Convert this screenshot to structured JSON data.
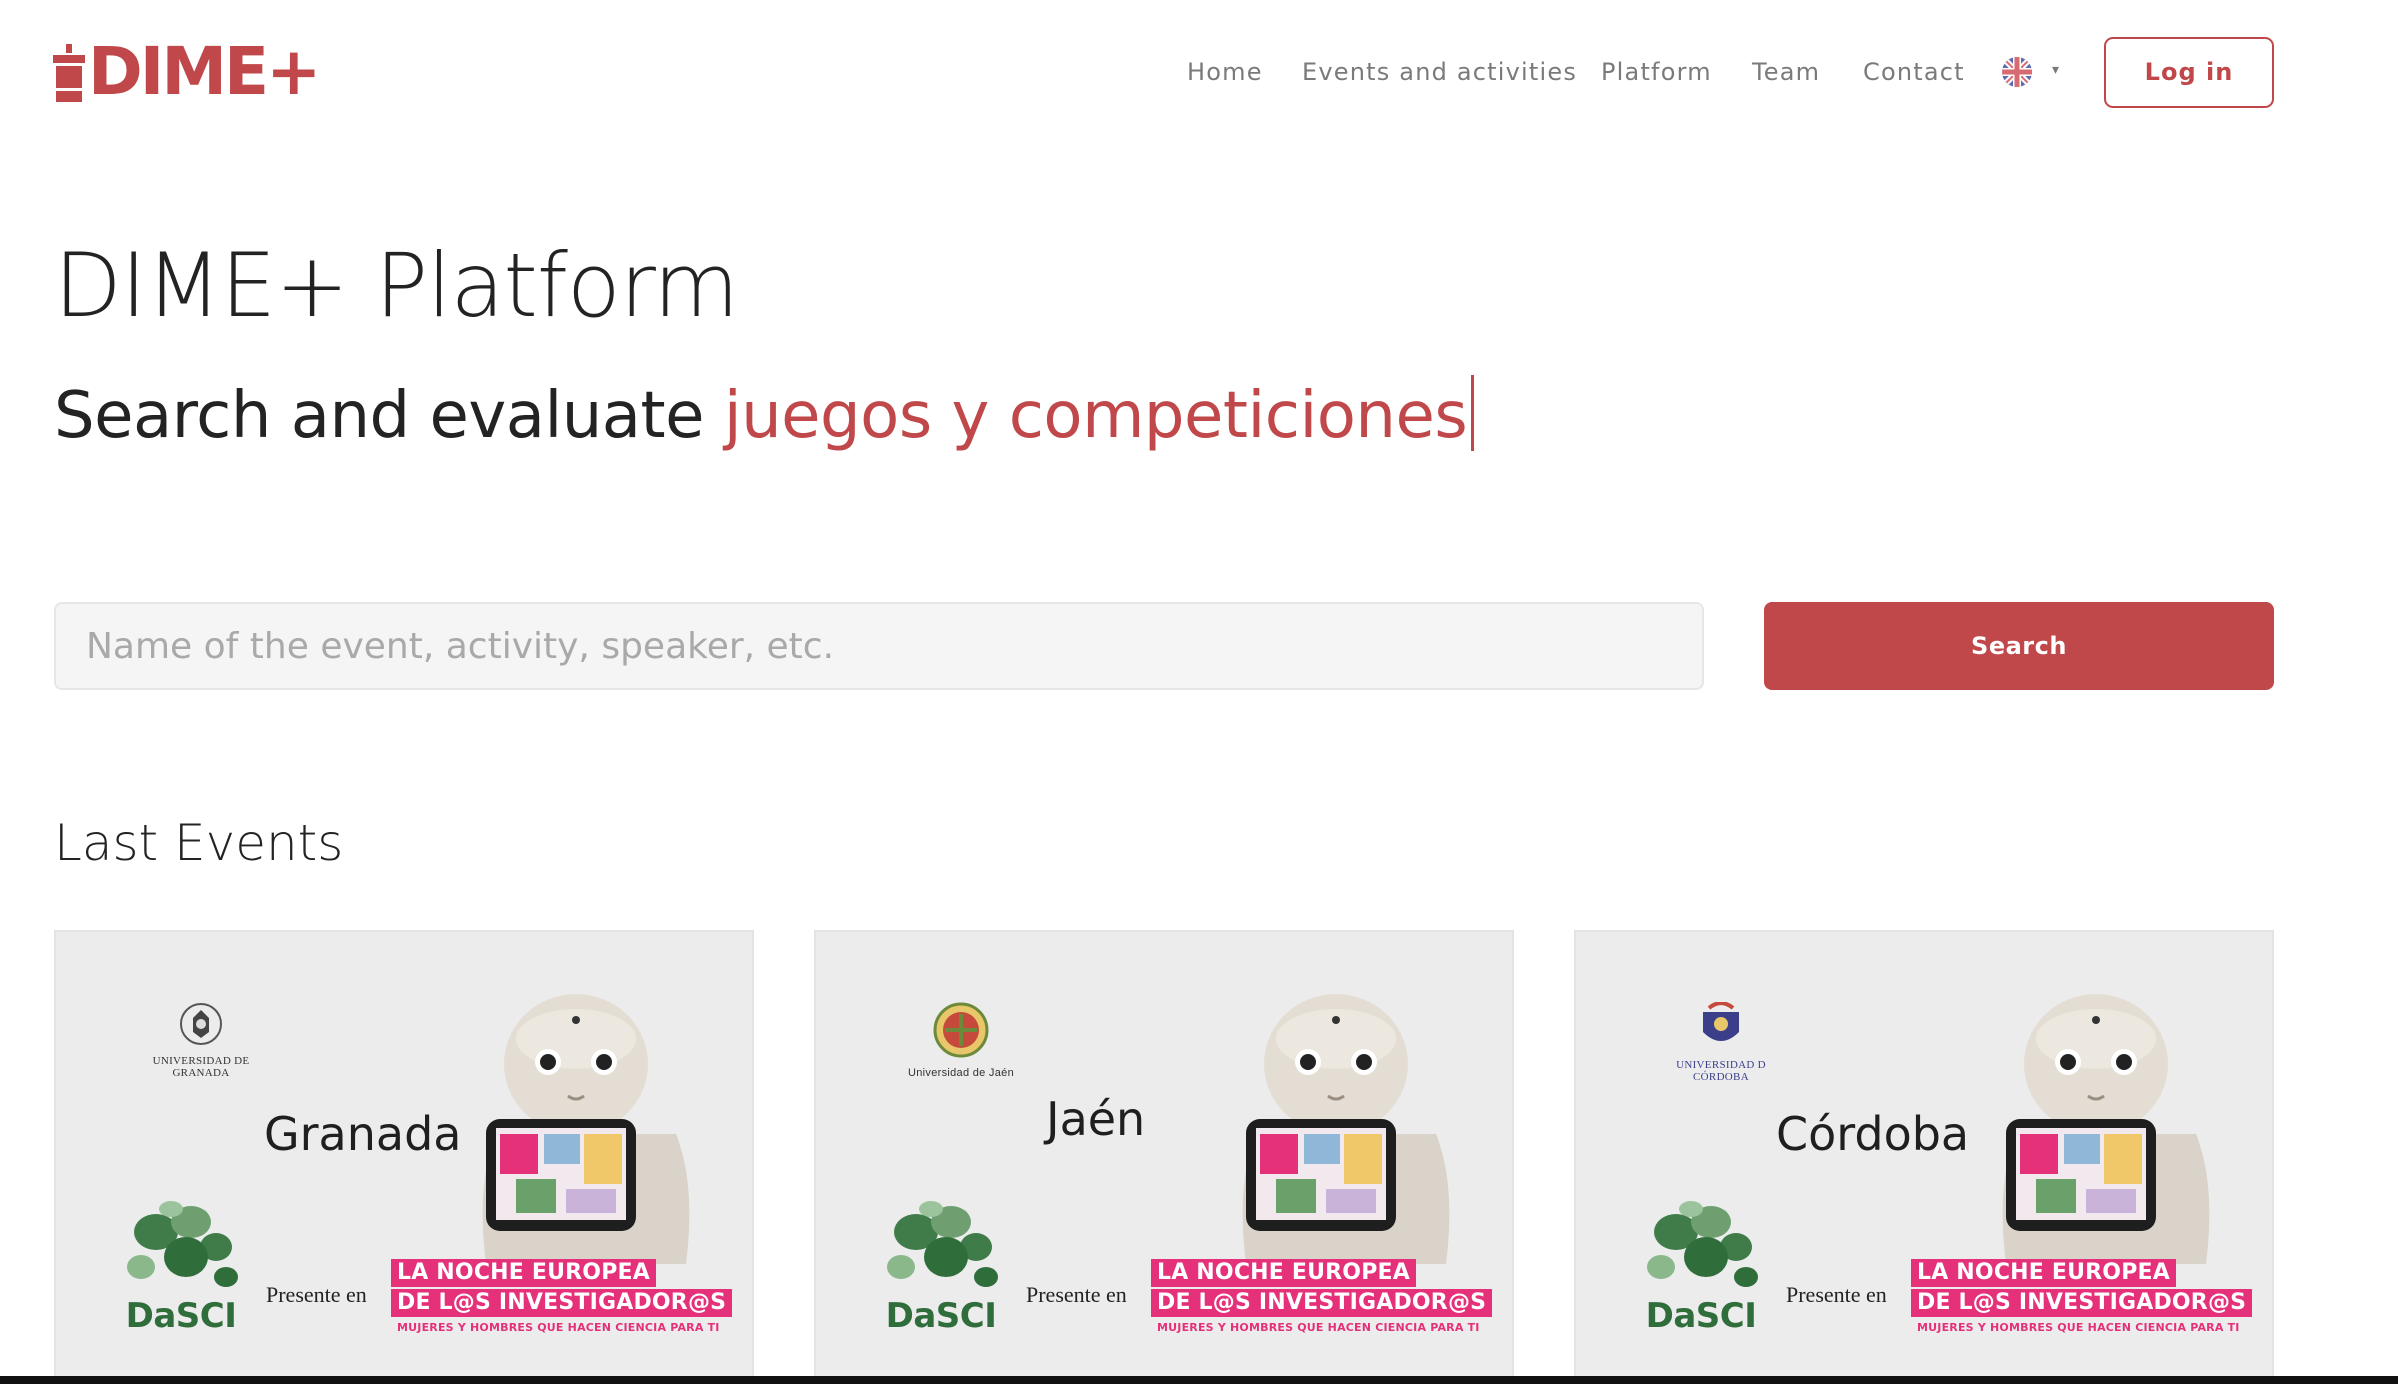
{
  "brand": {
    "logo_text": "DIME+",
    "logo_icon": "cake-icon",
    "accent_color": "#c0474a"
  },
  "nav": {
    "items": [
      {
        "label": "Home"
      },
      {
        "label": "Events and activities"
      },
      {
        "label": "Platform"
      },
      {
        "label": "Team"
      },
      {
        "label": "Contact"
      }
    ],
    "language_icon": "uk-flag-icon",
    "login_label": "Log in"
  },
  "hero": {
    "title": "DIME+ Platform",
    "subtitle_prefix": "Search and evaluate ",
    "subtitle_highlight": "juegos y competiciones"
  },
  "search": {
    "placeholder": "Name of the event, activity, speaker, etc.",
    "value": "",
    "button_label": "Search"
  },
  "events": {
    "section_title": "Last Events",
    "cards": [
      {
        "city": "Granada",
        "university": "UNIVERSIDAD DE GRANADA",
        "logo_label": "DaSCI",
        "presente": "Presente en",
        "banner_line1": "LA NOCHE EUROPEA",
        "banner_line2": "DE L@S INVESTIGADOR@S",
        "banner_tagline": "MUJERES Y HOMBRES QUE HACEN CIENCIA PARA TI"
      },
      {
        "city": "Jaén",
        "university": "Universidad de Jaén",
        "logo_label": "DaSCI",
        "presente": "Presente en",
        "banner_line1": "LA NOCHE EUROPEA",
        "banner_line2": "DE L@S INVESTIGADOR@S",
        "banner_tagline": "MUJERES Y HOMBRES QUE HACEN CIENCIA PARA TI"
      },
      {
        "city": "Córdoba",
        "university": "UNIVERSIDAD D CÓRDOBA",
        "logo_label": "DaSCI",
        "presente": "Presente en",
        "banner_line1": "LA NOCHE EUROPEA",
        "banner_line2": "DE L@S INVESTIGADOR@S",
        "banner_tagline": "MUJERES Y HOMBRES QUE HACEN CIENCIA PARA TI"
      }
    ]
  }
}
